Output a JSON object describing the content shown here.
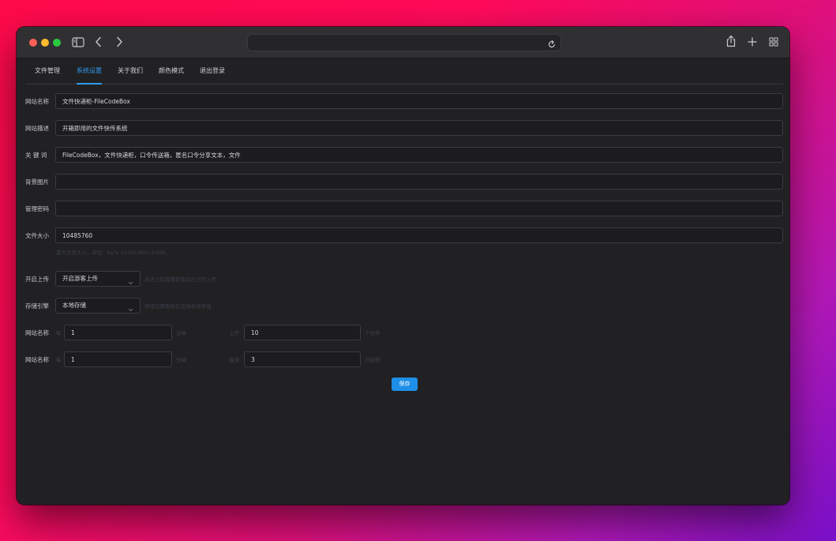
{
  "tabs": [
    {
      "label": "文件管理"
    },
    {
      "label": "系统设置"
    },
    {
      "label": "关于我们"
    },
    {
      "label": "颜色模式"
    },
    {
      "label": "退出登录"
    }
  ],
  "form": {
    "site_name": {
      "label": "网站名称",
      "value": "文件快递柜-FileCodeBox"
    },
    "site_desc": {
      "label": "网站描述",
      "value": "开箱即用的文件快传系统"
    },
    "keywords": {
      "label": "关 键 词",
      "value": "FileCodeBox，文件快递柜，口令传送箱，匿名口令分享文本，文件"
    },
    "background": {
      "label": "背景图片",
      "value": ""
    },
    "admin_password": {
      "label": "管理密码",
      "value": ""
    },
    "file_size": {
      "label": "文件大小",
      "value": "10485760",
      "hint": "最大文件大小，单位：byte 10485760=10MB"
    },
    "open_upload": {
      "label": "开启上传",
      "value": "开启游客上传",
      "hint": "关闭之后需要登录后台方可上传"
    },
    "storage": {
      "label": "存储引擎",
      "value": "本地存储",
      "hint": "存储引擎暂时仅支持本地存储"
    },
    "limit_row1": {
      "label": "网站名称",
      "pre": "每",
      "value1": "1",
      "mid1": "分钟",
      "mid2": "上传",
      "value2": "10",
      "post": "个文件"
    },
    "limit_row2": {
      "label": "网站名称",
      "pre": "每",
      "value1": "1",
      "mid1": "分钟",
      "mid2": "错误",
      "value2": "3",
      "post": "次封禁"
    }
  },
  "save_label": "保存",
  "colors": {
    "accent": "#2f9bf0",
    "button": "#1e8fe8",
    "panel": "#212123"
  },
  "icons": [
    "sidebar-icon",
    "back-icon",
    "forward-icon",
    "reload-icon",
    "share-icon",
    "new-tab-icon",
    "tab-overview-icon",
    "chevron-down-icon"
  ]
}
